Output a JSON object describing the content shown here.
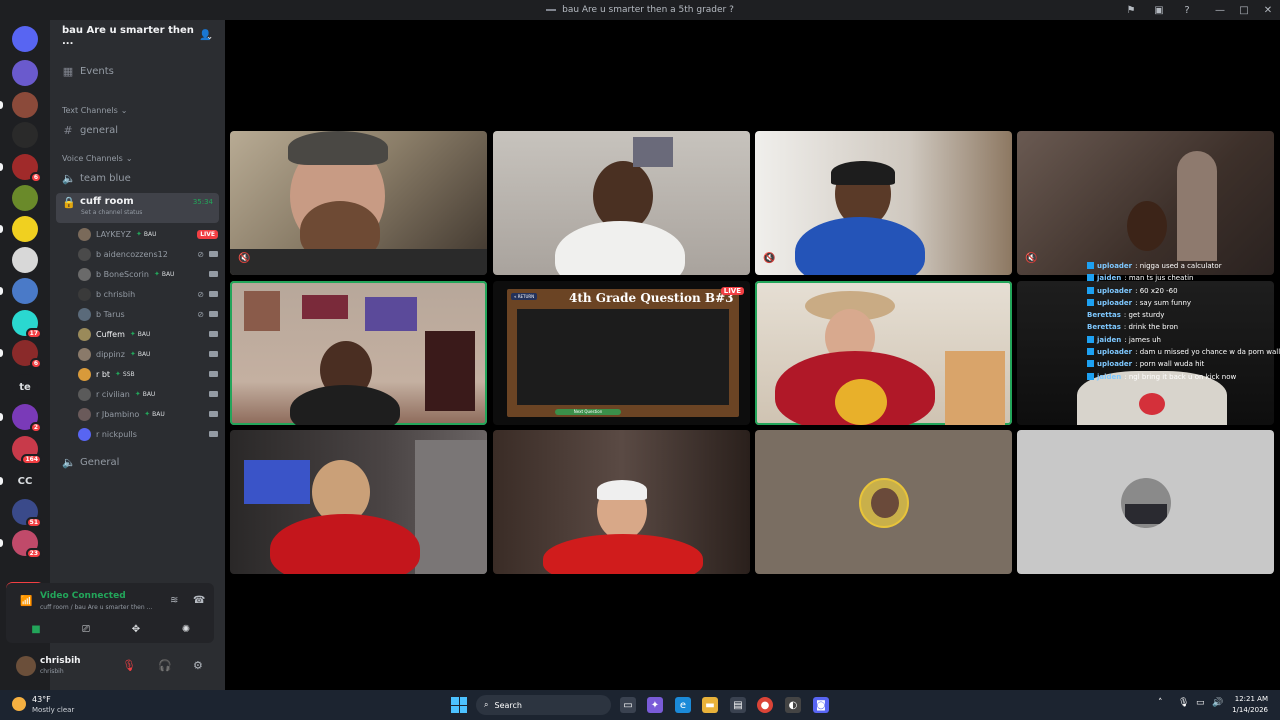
{
  "window": {
    "title": "bau Are u smarter then a 5th grader ?"
  },
  "rail": {
    "servers": [
      {
        "icon": "discord-home-icon",
        "label": ""
      },
      {
        "icon": "server-icon",
        "label": "",
        "badge": ""
      },
      {
        "icon": "server-icon",
        "label": "",
        "badge": ""
      },
      {
        "icon": "server-icon",
        "label": "",
        "badge": ""
      },
      {
        "icon": "server-icon",
        "label": "",
        "badge": "6"
      },
      {
        "icon": "server-icon",
        "label": "",
        "badge": ""
      },
      {
        "icon": "server-icon",
        "label": "",
        "badge": ""
      },
      {
        "icon": "server-icon",
        "label": "",
        "badge": ""
      },
      {
        "icon": "server-icon",
        "label": "",
        "badge": ""
      },
      {
        "icon": "server-icon",
        "label": "",
        "badge": "17"
      },
      {
        "icon": "server-icon",
        "label": "",
        "badge": "6"
      },
      {
        "icon": "server-icon",
        "label": "te",
        "badge": ""
      },
      {
        "icon": "server-icon",
        "label": "",
        "badge": "2"
      },
      {
        "icon": "server-icon",
        "label": "",
        "badge": "164"
      },
      {
        "icon": "server-icon",
        "label": "CC",
        "badge": ""
      },
      {
        "icon": "server-icon",
        "label": "",
        "badge": "51"
      },
      {
        "icon": "server-icon",
        "label": "",
        "badge": "23"
      }
    ],
    "new_label": "NEW"
  },
  "sidebar": {
    "guild_name": "bau Are u smarter then ...",
    "events_label": "Events",
    "text_category": "Text Channels",
    "text_channels": [
      "general"
    ],
    "voice_category": "Voice Channels",
    "voice_channels": {
      "team_blue": "team blue",
      "cuff_room": "cuff room",
      "cuff_room_timer": "35:34",
      "cuff_room_status": "Set a channel status",
      "general": "General"
    },
    "voice_users": [
      {
        "name": "LAYKEYZ",
        "tag": "BAU",
        "muted": false,
        "live": true
      },
      {
        "name": "b aidencozzens12",
        "tag": "",
        "muted": true,
        "live": false
      },
      {
        "name": "b BoneScorin",
        "tag": "BAU",
        "muted": false,
        "live": false
      },
      {
        "name": "b chrisbih",
        "tag": "",
        "muted": true,
        "live": false
      },
      {
        "name": "b Tarus",
        "tag": "",
        "muted": true,
        "live": false
      },
      {
        "name": "Cuffem",
        "tag": "BAU",
        "muted": false,
        "live": false
      },
      {
        "name": "dippinz",
        "tag": "BAU",
        "muted": false,
        "live": false
      },
      {
        "name": "r bt",
        "tag": "SSB",
        "muted": false,
        "live": false
      },
      {
        "name": "r civilian",
        "tag": "BAU",
        "muted": false,
        "live": false
      },
      {
        "name": "r Jbambino",
        "tag": "BAU",
        "muted": false,
        "live": false
      },
      {
        "name": "r nickpulls",
        "tag": "",
        "muted": false,
        "live": false
      }
    ],
    "live_label": "LIVE"
  },
  "voice_panel": {
    "title": "Video Connected",
    "subtitle": "cuff room / bau Are u smarter then ..."
  },
  "user": {
    "display_name": "chrisbih",
    "username": "chrisbih"
  },
  "stream": {
    "question_title": "4th Grade Question B#3",
    "return_label": "« RETURN",
    "next_label": "Next Question",
    "live_label": "LIVE"
  },
  "chat": [
    {
      "user": "uploader",
      "msg": ": nigga used a calculator",
      "icon": true
    },
    {
      "user": "jaiden",
      "msg": ": man ts jus cheatin",
      "icon": true
    },
    {
      "user": "uploader",
      "msg": ": 60 x20 -60",
      "icon": true
    },
    {
      "user": "uploader",
      "msg": ": say sum funny",
      "icon": true
    },
    {
      "user": "Berettas",
      "msg": ": get sturdy",
      "icon": false
    },
    {
      "user": "Berettas",
      "msg": ": drink the bron",
      "icon": false
    },
    {
      "user": "jaiden",
      "msg": ": james uh",
      "icon": true
    },
    {
      "user": "uploader",
      "msg": ": dam u missed yo chance w da porn wall",
      "icon": true
    },
    {
      "user": "uploader",
      "msg": ": porn wall wuda hit",
      "icon": true
    },
    {
      "user": "jaiden",
      "msg": ": ngl bring it back u on kick now",
      "icon": true
    }
  ],
  "taskbar": {
    "temperature": "43°F",
    "condition": "Mostly clear",
    "search_label": "Search",
    "time": "12:21 AM",
    "date": "1/14/2026"
  }
}
